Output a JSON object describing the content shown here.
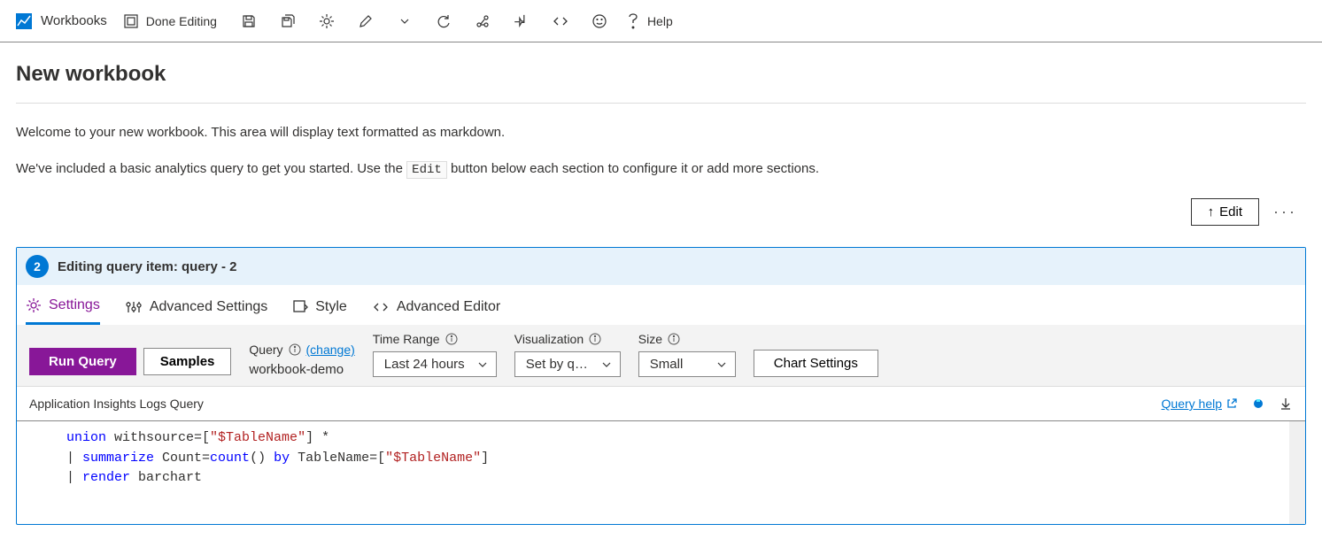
{
  "toolbar": {
    "workbooks_label": "Workbooks",
    "done_editing_label": "Done Editing",
    "help_label": "Help"
  },
  "page": {
    "title": "New workbook",
    "welcome_line1": "Welcome to your new workbook. This area will display text formatted as markdown.",
    "welcome_line2a": "We've included a basic analytics query to get you started. Use the ",
    "welcome_edit_token": "Edit",
    "welcome_line2b": " button below each section to configure it or add more sections."
  },
  "edit_row": {
    "move_up_label": "↑",
    "edit_label": "Edit"
  },
  "panel": {
    "step_number": "2",
    "header_text": "Editing query item: query - 2",
    "tabs": {
      "settings": "Settings",
      "advanced_settings": "Advanced Settings",
      "style": "Style",
      "advanced_editor": "Advanced Editor"
    },
    "controls": {
      "run_query": "Run Query",
      "samples": "Samples",
      "query_label": "Query",
      "change_link": "(change)",
      "query_value": "workbook-demo",
      "time_range_label": "Time Range",
      "time_range_value": "Last 24 hours",
      "visualization_label": "Visualization",
      "visualization_value": "Set by q…",
      "size_label": "Size",
      "size_value": "Small",
      "chart_settings": "Chart Settings"
    },
    "query_bar": {
      "title": "Application Insights Logs Query",
      "query_help": "Query help"
    },
    "code": {
      "line1_union": "union",
      "line1_rest": " withsource=[",
      "line1_str": "\"$TableName\"",
      "line1_end": "] *",
      "line2_pipe": "| ",
      "line2_summarize": "summarize",
      "line2_mid": " Count=",
      "line2_count": "count",
      "line2_paren": "() ",
      "line2_by": "by",
      "line2_after": " TableName=[",
      "line2_str": "\"$TableName\"",
      "line2_end": "]",
      "line3_pipe": "| ",
      "line3_render": "render",
      "line3_rest": " barchart"
    }
  }
}
